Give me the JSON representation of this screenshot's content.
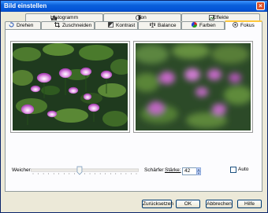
{
  "window": {
    "title": "Bild einstellen"
  },
  "tabs_row1": [
    {
      "label": "Histogramm",
      "icon": "histogram-icon"
    },
    {
      "label": "Ton",
      "icon": "tone-icon"
    },
    {
      "label": "Effekte",
      "icon": "effects-icon"
    }
  ],
  "tabs_row2": [
    {
      "label": "Drehen",
      "icon": "rotate-icon"
    },
    {
      "label": "Zuschneiden",
      "icon": "crop-icon"
    },
    {
      "label": "Kontrast",
      "icon": "contrast-icon"
    },
    {
      "label": "Balance",
      "icon": "balance-icon"
    },
    {
      "label": "Farben",
      "icon": "colors-icon"
    },
    {
      "label": "Fokus",
      "icon": "focus-icon",
      "active": true
    }
  ],
  "focus": {
    "softer_label": "Weicher",
    "sharper_label": "Schärfer",
    "strength_label": "Stärke:",
    "strength_value": "42",
    "auto_label": "Auto",
    "auto_checked": false,
    "slider_fraction": 0.45
  },
  "buttons": {
    "reset": "Zurücksetzen",
    "ok": "OK",
    "cancel": "Abbrechen",
    "help": "Hilfe"
  },
  "colors": {
    "accent": "#0a5fdb",
    "active_tab": "#ffc83c"
  }
}
